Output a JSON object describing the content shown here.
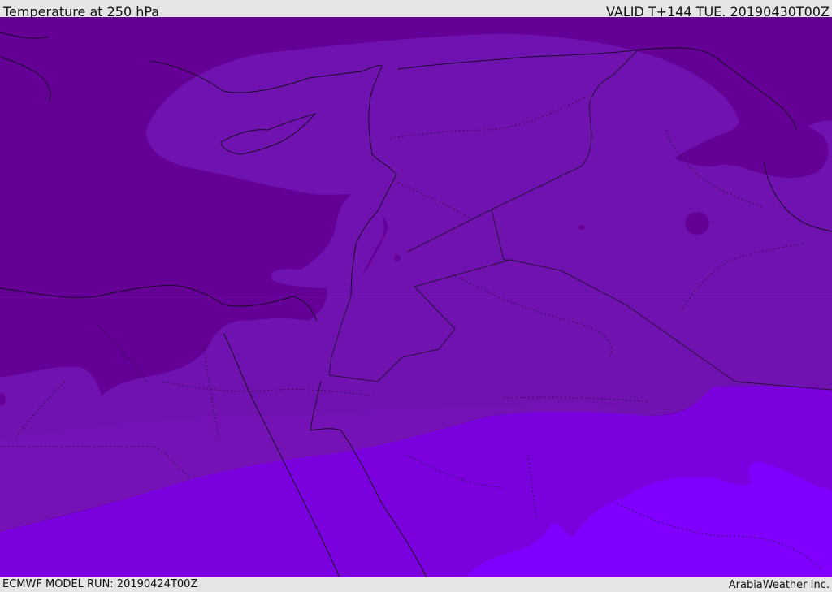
{
  "header": {
    "title": "Temperature at 250 hPa",
    "valid_time": "VALID T+144 TUE. 20190430T00Z"
  },
  "footer": {
    "model_run": "ECMWF MODEL RUN: 20190424T00Z",
    "credit": "ArabiaWeather Inc."
  },
  "colors": {
    "band_darkest": "#650097",
    "band_dark": "#7012b0",
    "band_mid": "#780fbb",
    "band_light": "#7a00dd",
    "band_lightest": "#7f00ff",
    "coast_line": "#1a0a2a",
    "border_line": "#2a103f"
  }
}
